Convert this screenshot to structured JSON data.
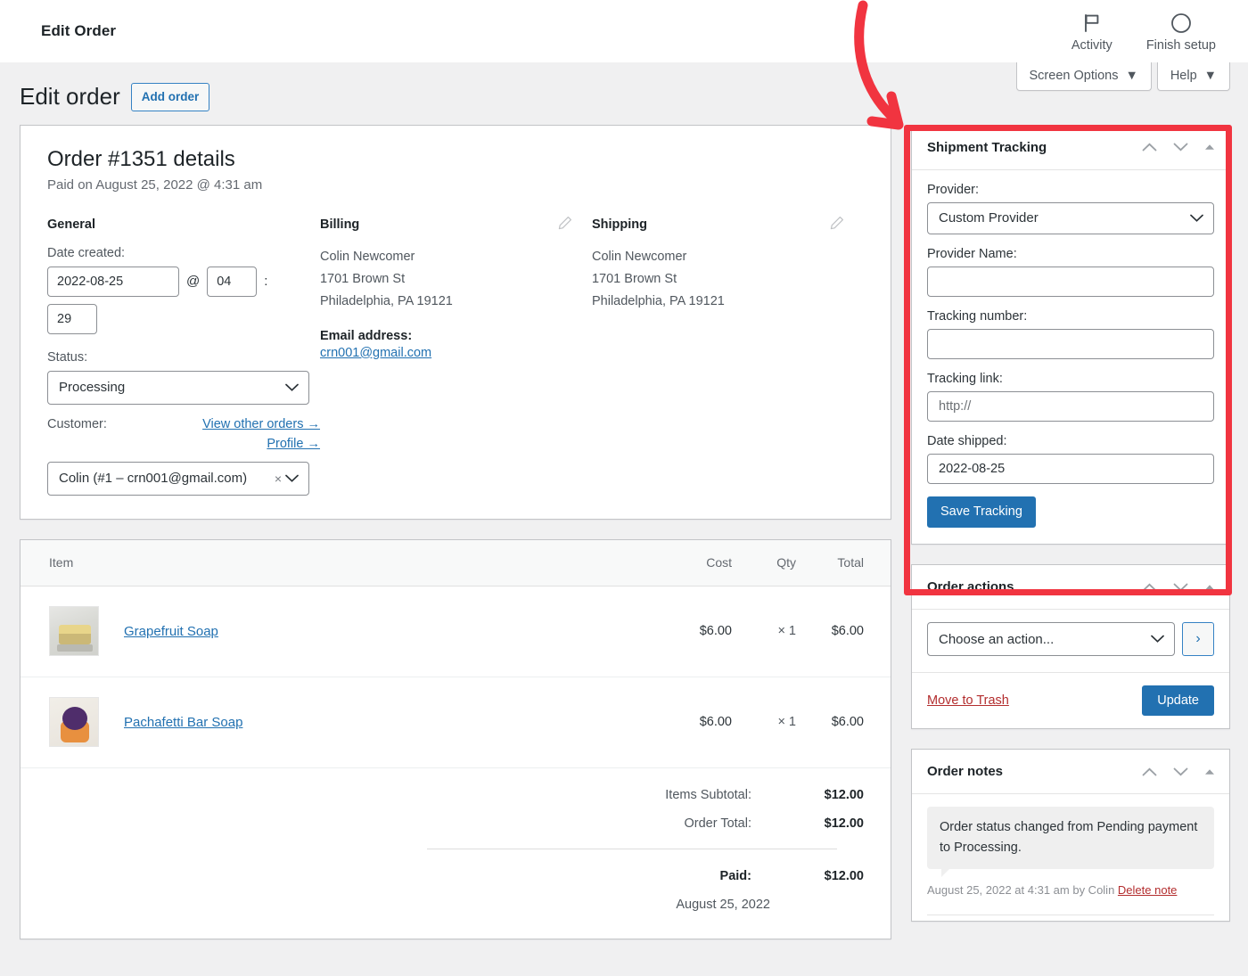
{
  "adminbar": {
    "title": "Edit Order",
    "items": [
      {
        "label": "Activity",
        "icon": "flag-icon"
      },
      {
        "label": "Finish setup",
        "icon": "circle-progress-icon"
      }
    ]
  },
  "screen_meta": {
    "screen_options": "Screen Options",
    "help": "Help"
  },
  "page": {
    "title": "Edit order",
    "add_order_label": "Add order"
  },
  "order": {
    "heading": "Order #1351 details",
    "paid_on": "Paid on August 25, 2022 @ 4:31 am",
    "general": {
      "heading": "General",
      "date_created_label": "Date created:",
      "date_value": "2022-08-25",
      "at_symbol": "@",
      "hour_value": "04",
      "colon": ":",
      "minute_value": "29",
      "status_label": "Status:",
      "status_value": "Processing",
      "customer_label": "Customer:",
      "view_other_orders": "View other orders →",
      "profile_link": "Profile →",
      "customer_value": "Colin (#1 – crn001@gmail.com)"
    },
    "billing": {
      "heading": "Billing",
      "name": "Colin Newcomer",
      "street": "1701 Brown St",
      "citystate": "Philadelphia, PA 19121",
      "email_label": "Email address:",
      "email": "crn001@gmail.com"
    },
    "shipping": {
      "heading": "Shipping",
      "name": "Colin Newcomer",
      "street": "1701 Brown St",
      "citystate": "Philadelphia, PA 19121"
    }
  },
  "items": {
    "columns": {
      "item": "Item",
      "cost": "Cost",
      "qty": "Qty",
      "total": "Total"
    },
    "rows": [
      {
        "name": "Grapefruit Soap",
        "cost": "$6.00",
        "qty": "× 1",
        "total": "$6.00"
      },
      {
        "name": "Pachafetti Bar Soap",
        "cost": "$6.00",
        "qty": "× 1",
        "total": "$6.00"
      }
    ],
    "totals": [
      {
        "label": "Items Subtotal:",
        "value": "$12.00"
      },
      {
        "label": "Order Total:",
        "value": "$12.00"
      }
    ],
    "paid": {
      "label": "Paid:",
      "value": "$12.00",
      "date": "August 25, 2022"
    }
  },
  "shipment_tracking": {
    "title": "Shipment Tracking",
    "provider_label": "Provider:",
    "provider_value": "Custom Provider",
    "provider_name_label": "Provider Name:",
    "provider_name_value": "",
    "tracking_number_label": "Tracking number:",
    "tracking_number_value": "",
    "tracking_link_label": "Tracking link:",
    "tracking_link_value": "http://",
    "date_shipped_label": "Date shipped:",
    "date_shipped_value": "2022-08-25",
    "save_button": "Save Tracking"
  },
  "order_actions": {
    "title": "Order actions",
    "action_select_value": "Choose an action...",
    "go_label": "›",
    "trash_label": "Move to Trash",
    "update_label": "Update"
  },
  "order_notes": {
    "title": "Order notes",
    "notes": [
      {
        "text": "Order status changed from Pending payment to Processing.",
        "meta_prefix": "August 25, 2022 at 4:31 am by Colin ",
        "delete_label": "Delete note"
      }
    ]
  },
  "colors": {
    "annotation_red": "#f13440",
    "primary_blue": "#2271b1",
    "link_blue": "#2271b1",
    "danger_red": "#b32d2e"
  }
}
